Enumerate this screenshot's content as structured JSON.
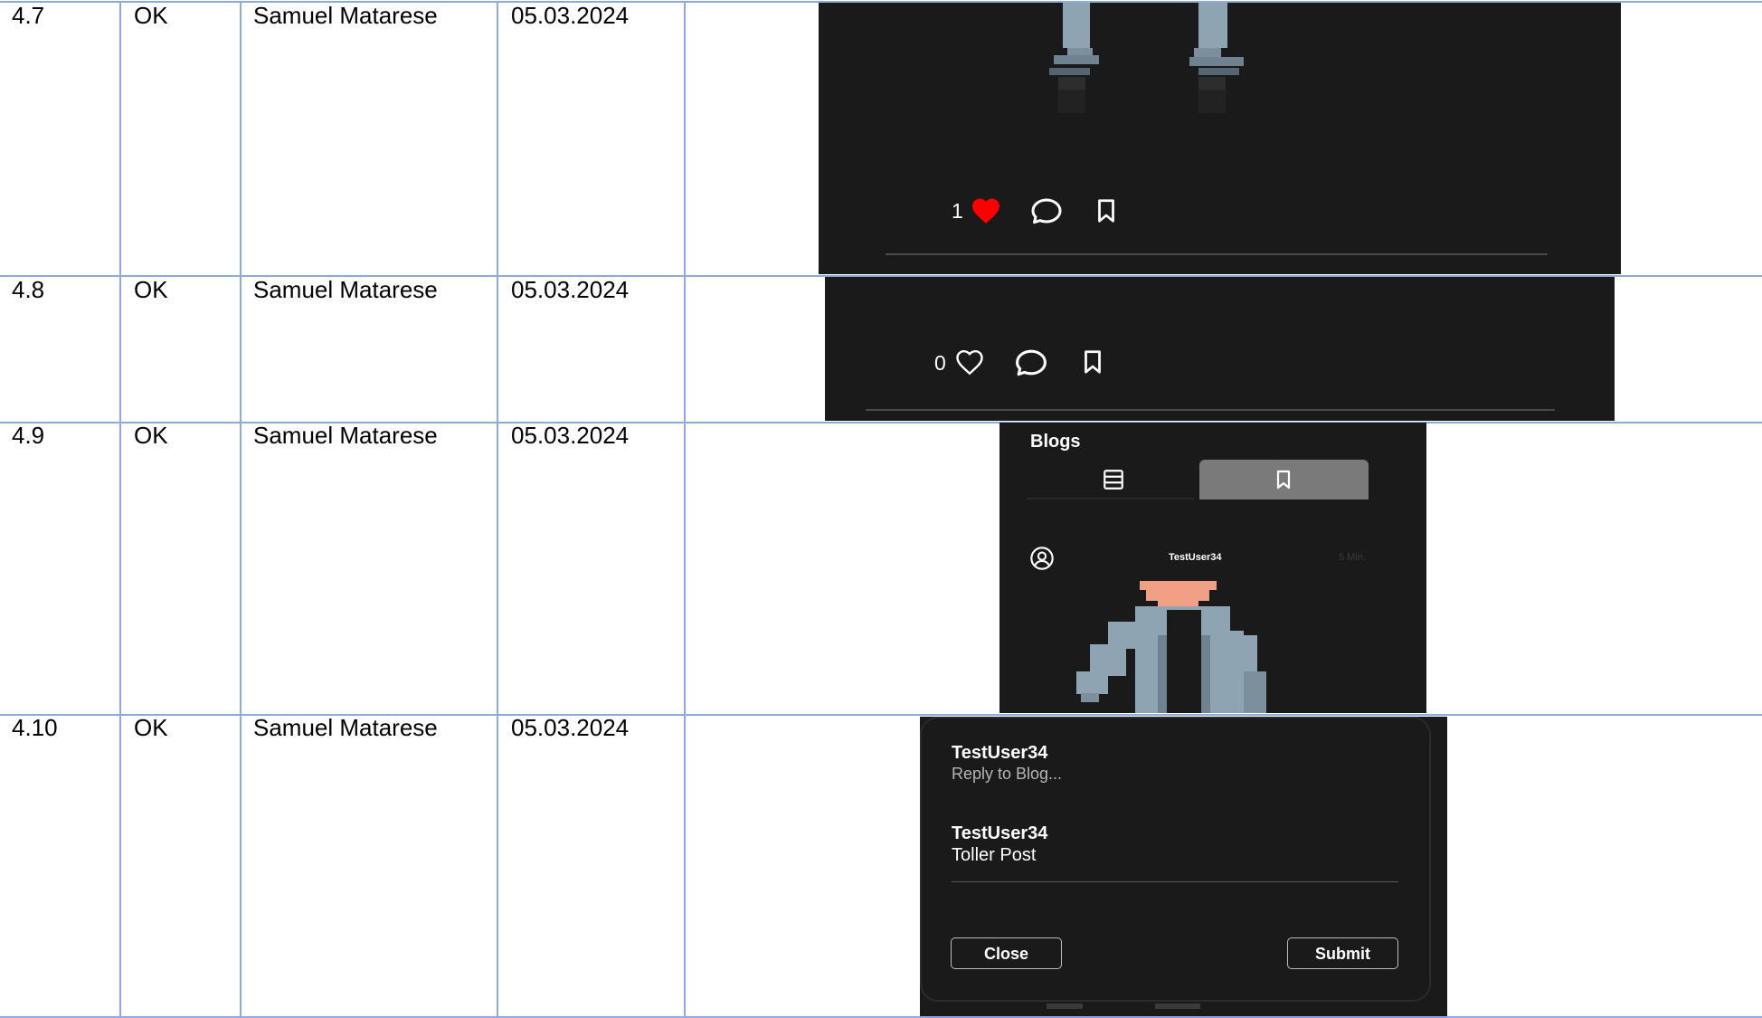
{
  "rows": [
    {
      "id": "4.7",
      "status": "OK",
      "tester": "Samuel Matarese",
      "date": "05.03.2024"
    },
    {
      "id": "4.8",
      "status": "OK",
      "tester": "Samuel Matarese",
      "date": "05.03.2024"
    },
    {
      "id": "4.9",
      "status": "OK",
      "tester": "Samuel Matarese",
      "date": "05.03.2024"
    },
    {
      "id": "4.10",
      "status": "OK",
      "tester": "Samuel Matarese",
      "date": "05.03.2024"
    }
  ],
  "shot_4_7": {
    "like_count": "1",
    "liked": true,
    "icons": [
      "heart-filled-icon",
      "comment-icon",
      "bookmark-icon"
    ]
  },
  "shot_4_8": {
    "like_count": "0",
    "liked": false,
    "icons": [
      "heart-outline-icon",
      "comment-icon",
      "bookmark-icon"
    ]
  },
  "shot_4_9": {
    "header": "Blogs",
    "tabs": [
      "list-icon",
      "bookmark-icon"
    ],
    "post_user": "TestUser34",
    "post_time": "5 Min."
  },
  "shot_4_10": {
    "comments": [
      {
        "user": "TestUser34",
        "text": "Reply to Blog..."
      },
      {
        "user": "TestUser34",
        "text": "Toller Post"
      }
    ],
    "close_label": "Close",
    "submit_label": "Submit"
  },
  "colors": {
    "grid": "#8eaadb",
    "dark_bg": "#1b1a1b",
    "like_red": "#ff0000",
    "active_tab": "#7a7a7a"
  }
}
